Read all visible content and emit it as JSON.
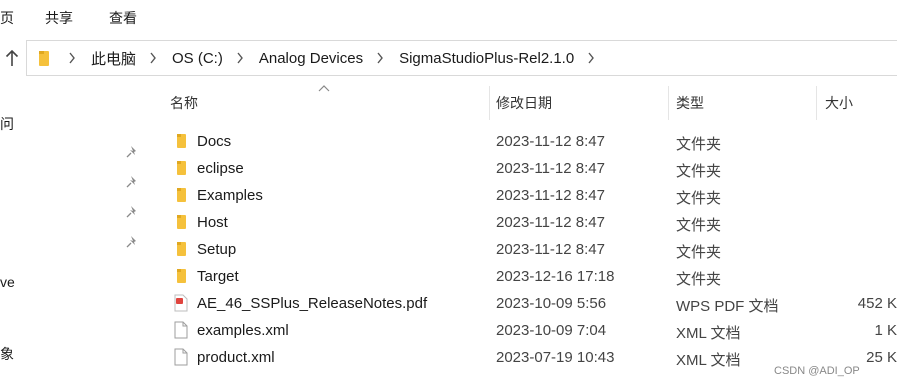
{
  "ribbon": {
    "tabs": [
      "页",
      "共享",
      "查看"
    ]
  },
  "address": {
    "up_icon": "arrow-up-icon",
    "breadcrumbs": [
      "此电脑",
      "OS (C:)",
      "Analog Devices",
      "SigmaStudioPlus-Rel2.1.0"
    ]
  },
  "nav": {
    "items": [
      "问",
      "ve",
      "象"
    ]
  },
  "columns": {
    "name": "名称",
    "date": "修改日期",
    "type": "类型",
    "size": "大小"
  },
  "files": [
    {
      "name": "Docs",
      "date": "2023-11-12 8:47",
      "type": "文件夹",
      "size": "",
      "icon": "folder-icon"
    },
    {
      "name": "eclipse",
      "date": "2023-11-12 8:47",
      "type": "文件夹",
      "size": "",
      "icon": "folder-icon"
    },
    {
      "name": "Examples",
      "date": "2023-11-12 8:47",
      "type": "文件夹",
      "size": "",
      "icon": "folder-icon"
    },
    {
      "name": "Host",
      "date": "2023-11-12 8:47",
      "type": "文件夹",
      "size": "",
      "icon": "folder-icon"
    },
    {
      "name": "Setup",
      "date": "2023-11-12 8:47",
      "type": "文件夹",
      "size": "",
      "icon": "folder-icon"
    },
    {
      "name": "Target",
      "date": "2023-12-16 17:18",
      "type": "文件夹",
      "size": "",
      "icon": "folder-icon"
    },
    {
      "name": "AE_46_SSPlus_ReleaseNotes.pdf",
      "date": "2023-10-09 5:56",
      "type": "WPS PDF 文档",
      "size": "452 K",
      "icon": "pdf-icon"
    },
    {
      "name": "examples.xml",
      "date": "2023-10-09 7:04",
      "type": "XML 文档",
      "size": "1 K",
      "icon": "xml-file-icon"
    },
    {
      "name": "product.xml",
      "date": "2023-07-19 10:43",
      "type": "XML 文档",
      "size": "25 K",
      "icon": "xml-file-icon"
    }
  ],
  "watermark": "CSDN @ADI_OP",
  "colors": {
    "folder": "#f5c13c",
    "pdf": "#e0443e",
    "pin": "#8a8a8a"
  }
}
